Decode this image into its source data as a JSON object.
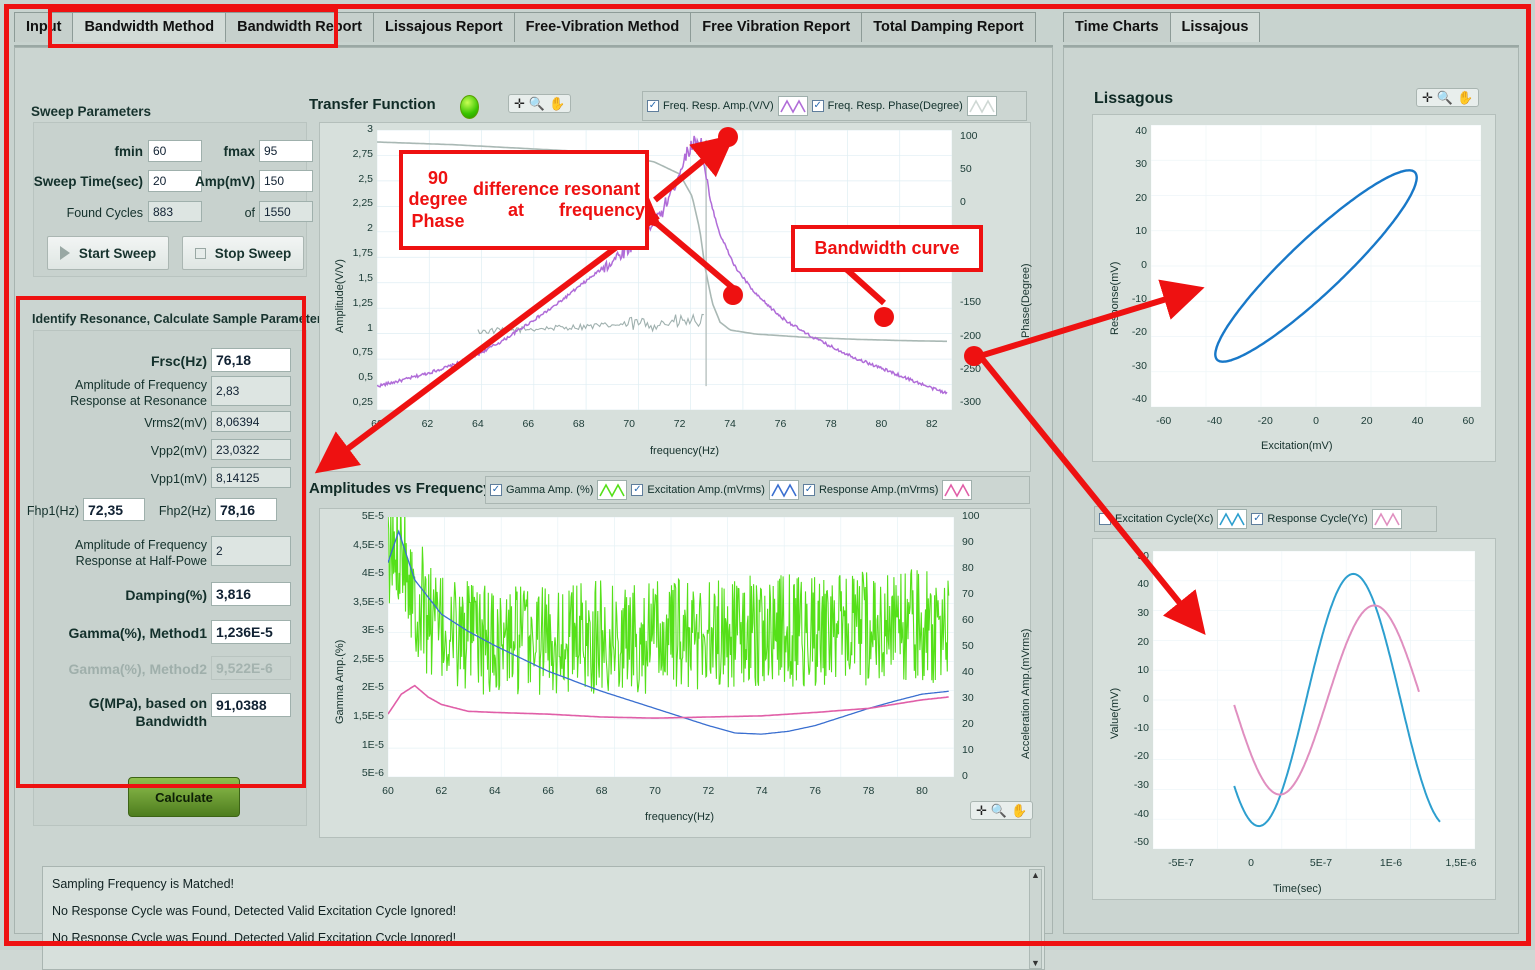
{
  "tabs_left": [
    {
      "label": "Input",
      "active": false
    },
    {
      "label": "Bandwidth Method",
      "active": true
    },
    {
      "label": "Bandwidth Report",
      "active": false
    },
    {
      "label": "Lissajous Report",
      "active": false
    },
    {
      "label": "Free-Vibration Method",
      "active": false
    },
    {
      "label": "Free Vibration Report",
      "active": false
    },
    {
      "label": "Total Damping Report",
      "active": false
    }
  ],
  "tabs_right": [
    {
      "label": "Time Charts",
      "active": false
    },
    {
      "label": "Lissajous",
      "active": true
    }
  ],
  "sweep": {
    "title": "Sweep Parameters",
    "fmin_label": "fmin",
    "fmin_value": "60",
    "fmax_label": "fmax",
    "fmax_value": "95",
    "sweeptime_label": "Sweep Time(sec)",
    "sweeptime_value": "20",
    "amp_label": "Amp(mV)",
    "amp_value": "150",
    "foundcycles_label": "Found Cycles",
    "foundcycles_value": "883",
    "of_label": "of",
    "of_value": "1550",
    "start_label": "Start Sweep",
    "stop_label": "Stop Sweep"
  },
  "resonance": {
    "title": "Identify Resonance, Calculate Sample Parameters",
    "frsc_label": "Frsc(Hz)",
    "frsc_value": "76,18",
    "amp_res_label_1": "Amplitude of Frequency",
    "amp_res_label_2": "Response at Resonance",
    "amp_res_value": "2,83",
    "vrms2_label": "Vrms2(mV)",
    "vrms2_value": "8,06394",
    "vpp2_label": "Vpp2(mV)",
    "vpp2_value": "23,0322",
    "vpp1_label": "Vpp1(mV)",
    "vpp1_value": "8,14125",
    "fhp1_label": "Fhp1(Hz)",
    "fhp1_value": "72,35",
    "fhp2_label": "Fhp2(Hz)",
    "fhp2_value": "78,16",
    "amp_hp_label_1": "Amplitude of Frequency",
    "amp_hp_label_2": "Response at Half-Powe",
    "amp_hp_value": "2",
    "damping_label": "Damping(%)",
    "damping_value": "3,816",
    "gamma1_label": "Gamma(%), Method1",
    "gamma1_value": "1,236E-5",
    "gamma2_label": "Gamma(%), Method2",
    "gamma2_value": "9,522E-6",
    "g_label_1": "G(MPa), based on",
    "g_label_2": "Bandwidth",
    "g_value": "91,0388",
    "calculate_label": "Calculate"
  },
  "annotations": [
    {
      "id": "phase-note",
      "text": "90 degree Phase\ndifference at\nresonant frequency"
    },
    {
      "id": "bandwidth-note",
      "text": "Bandwidth curve"
    }
  ],
  "messages": {
    "lines": [
      "Sampling Frequency is Matched!",
      "No Response Cycle was Found, Detected Valid Excitation Cycle Ignored!",
      "No Response Cycle was Found, Detected Valid Excitation Cycle Ignored!"
    ]
  },
  "chart_data": [
    {
      "id": "transfer-function",
      "type": "line",
      "title": "Transfer Function",
      "xlabel": "frequency(Hz)",
      "ylabel": "Amplitude(V/V)",
      "y2label": "Phase(Degree)",
      "xlim": [
        60,
        82.8
      ],
      "ylim": [
        0.18,
        3.0
      ],
      "y2lim": [
        -310,
        110
      ],
      "xticks": [
        60,
        62,
        64,
        66,
        68,
        70,
        72,
        74,
        76,
        78,
        80,
        82
      ],
      "yticks": [
        "3",
        "2,75",
        "2,5",
        "2,25",
        "2",
        "1,75",
        "1,5",
        "1,25",
        "1",
        "0,75",
        "0,5",
        "0,25"
      ],
      "ytickvals": [
        3,
        2.75,
        2.5,
        2.25,
        2,
        1.75,
        1.5,
        1.25,
        1,
        0.75,
        0.5,
        0.25
      ],
      "y2ticks": [
        "100",
        "50",
        "0",
        "-50",
        "-100",
        "-150",
        "-200",
        "-250",
        "-300"
      ],
      "y2tickvals": [
        100,
        50,
        0,
        -50,
        -100,
        -150,
        -200,
        -250,
        -300
      ],
      "grid": true,
      "legend_position": "top-right",
      "series": [
        {
          "name": "Freq. Resp. Amp.(V/V)",
          "color": "#b06cd8",
          "checked": true,
          "axis": "left",
          "x": [
            60,
            61,
            62,
            63,
            64,
            65,
            66,
            67,
            68,
            69,
            70,
            70.6,
            71.2,
            71.8,
            72.2,
            72.5,
            72.7,
            72.85,
            73,
            73.2,
            73.6,
            74.2,
            75,
            76,
            77,
            78,
            79,
            80,
            81,
            82,
            82.6
          ],
          "y": [
            0.42,
            0.48,
            0.55,
            0.63,
            0.74,
            0.88,
            1.05,
            1.22,
            1.42,
            1.62,
            1.82,
            1.98,
            2.12,
            2.45,
            2.72,
            2.86,
            2.9,
            2.88,
            2.6,
            2.3,
            1.95,
            1.62,
            1.35,
            1.12,
            0.95,
            0.82,
            0.7,
            0.6,
            0.5,
            0.4,
            0.35
          ]
        },
        {
          "name": "Freq. Resp. Phase(Degree)",
          "color": "#a9b8b4",
          "checked": true,
          "axis": "right",
          "x": [
            60,
            63,
            66,
            68,
            70,
            71,
            72,
            72.5,
            72.8,
            73,
            73.3,
            73.6,
            74,
            75,
            77,
            79,
            81,
            82.6
          ],
          "y": [
            92,
            88,
            82,
            78,
            70,
            62,
            44,
            10,
            -40,
            -95,
            -150,
            -178,
            -190,
            -196,
            -201,
            -204,
            -206,
            -207
          ]
        }
      ],
      "annotations": [
        "90 degree Phase difference at resonant frequency",
        "Bandwidth curve"
      ]
    },
    {
      "id": "amplitudes-vs-frequency",
      "type": "line",
      "title": "Amplitudes vs Frequency",
      "xlabel": "frequency(Hz)",
      "ylabel": "Gamma Amp.(%)",
      "y2label": "Acceleration Amp.(mVrms)",
      "xlim": [
        60,
        81.2
      ],
      "ylim": [
        4.5e-06,
        5e-05
      ],
      "y2lim": [
        0,
        100
      ],
      "xticks": [
        60,
        62,
        64,
        66,
        68,
        70,
        72,
        74,
        76,
        78,
        80
      ],
      "yticks": [
        "5E-5",
        "4,5E-5",
        "4E-5",
        "3,5E-5",
        "3E-5",
        "2,5E-5",
        "2E-5",
        "1,5E-5",
        "1E-5",
        "5E-6"
      ],
      "ytickvals": [
        5e-05,
        4.5e-05,
        4e-05,
        3.5e-05,
        3e-05,
        2.5e-05,
        2e-05,
        1.5e-05,
        1e-05,
        5e-06
      ],
      "y2ticks": [
        "100",
        "90",
        "80",
        "70",
        "60",
        "50",
        "40",
        "30",
        "20",
        "10",
        "0"
      ],
      "y2tickvals": [
        100,
        90,
        80,
        70,
        60,
        50,
        40,
        30,
        20,
        10,
        0
      ],
      "grid": true,
      "legend_position": "top",
      "series": [
        {
          "name": "Gamma Amp. (%)",
          "color": "#55e019",
          "checked": true,
          "axis": "left",
          "noisy": true,
          "x": [
            60,
            60.5,
            61,
            62,
            64,
            66,
            68,
            70,
            72,
            74,
            76,
            78,
            80,
            81
          ],
          "y": [
            4.1e-05,
            4.8e-05,
            3.6e-05,
            3e-05,
            2.8e-05,
            2.9e-05,
            2.9e-05,
            2.9e-05,
            2.95e-05,
            3e-05,
            3e-05,
            3.05e-05,
            3.1e-05,
            3e-05
          ]
        },
        {
          "name": "Excitation Amp.(mVrms)",
          "color": "#3a6fd0",
          "checked": true,
          "axis": "left",
          "x": [
            60,
            60.4,
            61,
            62,
            63,
            64,
            66,
            68,
            70,
            72,
            73,
            74,
            75,
            76,
            77,
            78,
            79,
            80,
            81
          ],
          "y": [
            4.2e-05,
            4.75e-05,
            3.9e-05,
            3.3e-05,
            3e-05,
            2.75e-05,
            2.3e-05,
            1.95e-05,
            1.65e-05,
            1.35e-05,
            1.22e-05,
            1.2e-05,
            1.25e-05,
            1.35e-05,
            1.5e-05,
            1.65e-05,
            1.78e-05,
            1.9e-05,
            1.95e-05
          ]
        },
        {
          "name": "Response Amp.(mVrms)",
          "color": "#e05fa8",
          "checked": true,
          "axis": "left",
          "x": [
            60,
            60.5,
            61,
            61.5,
            62,
            63,
            64,
            66,
            68,
            70,
            72,
            74,
            76,
            78,
            80,
            81
          ],
          "y": [
            1.55e-05,
            1.9e-05,
            2.05e-05,
            1.85e-05,
            1.72e-05,
            1.6e-05,
            1.58e-05,
            1.55e-05,
            1.5e-05,
            1.48e-05,
            1.5e-05,
            1.52e-05,
            1.58e-05,
            1.65e-05,
            1.8e-05,
            1.85e-05
          ]
        }
      ]
    },
    {
      "id": "lissagous",
      "type": "scatter",
      "title": "Lissagous",
      "xlabel": "Excitation(mV)",
      "ylabel": "Response(mV)",
      "xlim": [
        -65,
        65
      ],
      "ylim": [
        -42,
        42
      ],
      "xticks": [
        -60,
        -40,
        -20,
        0,
        20,
        40,
        60
      ],
      "yticks": [
        40,
        30,
        20,
        10,
        0,
        -10,
        -20,
        -30,
        -40
      ],
      "grid": true,
      "ellipse": {
        "a": 48,
        "b": 9,
        "angle_deg": 35,
        "color": "#1878c8",
        "linewidth": 2.4
      }
    },
    {
      "id": "cycles",
      "type": "line",
      "title": "",
      "xlabel": "Time(sec)",
      "ylabel": "Value(mV)",
      "xlim": [
        -7e-07,
        1.6e-06
      ],
      "ylim": [
        -52,
        52
      ],
      "xticks": [
        "-5E-7",
        "0",
        "5E-7",
        "1E-6",
        "1,5E-6"
      ],
      "xtickvals": [
        -5e-07,
        0,
        5e-07,
        1e-06,
        1.5e-06
      ],
      "yticks": [
        50,
        40,
        30,
        20,
        10,
        0,
        -10,
        -20,
        -30,
        -40,
        -50
      ],
      "grid": true,
      "series": [
        {
          "name": "Excitation Cycle(Xc)",
          "color": "#2d9fcf",
          "checked": false,
          "amplitude": 44,
          "phase_deg": -105,
          "period": 1.35e-06,
          "x_start": -1.2e-07,
          "x_end": 1.35e-06
        },
        {
          "name": "Response Cycle(Yc)",
          "color": "#e08fc0",
          "checked": true,
          "amplitude": 33,
          "phase_deg": -145,
          "period": 1.35e-06,
          "x_start": -1.2e-07,
          "x_end": 1.2e-06
        }
      ]
    }
  ],
  "legends": {
    "transfer": [
      {
        "label": "Freq. Resp. Amp.(V/V)",
        "checked": true,
        "color": "#b06cd8"
      },
      {
        "label": "Freq. Resp. Phase(Degree)",
        "checked": true,
        "color": "#cfd8d4"
      }
    ],
    "amplitudes": [
      {
        "label": "Gamma Amp. (%)",
        "checked": true,
        "color": "#55e019"
      },
      {
        "label": "Excitation Amp.(mVrms)",
        "checked": true,
        "color": "#3a6fd0"
      },
      {
        "label": "Response Amp.(mVrms)",
        "checked": true,
        "color": "#e05fa8"
      }
    ],
    "cycles": [
      {
        "label": "Excitation Cycle(Xc)",
        "checked": false,
        "color": "#2d9fcf"
      },
      {
        "label": "Response Cycle(Yc)",
        "checked": true,
        "color": "#e08fc0"
      }
    ]
  },
  "icons": {
    "crosshair": "✛",
    "zoom": "🔍",
    "hand": "✋",
    "led": "green-led",
    "scroll_up": "▲",
    "scroll_down": "▼"
  }
}
